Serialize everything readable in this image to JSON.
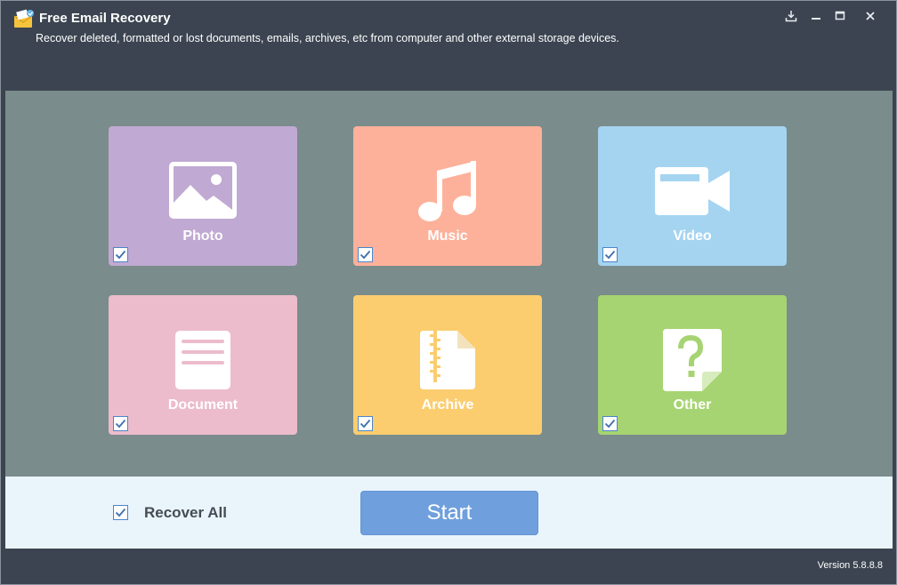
{
  "window": {
    "title": "Free Email Recovery",
    "subtitle": "Recover deleted, formatted or lost documents, emails, archives, etc from computer and other external storage devices.",
    "controls": [
      "download-icon",
      "minimize-icon",
      "maximize-icon",
      "close-icon"
    ]
  },
  "categories": [
    {
      "label": "Photo",
      "checked": true,
      "color": "#c0a9d2",
      "icon": "photo-icon"
    },
    {
      "label": "Music",
      "checked": true,
      "color": "#fdb19a",
      "icon": "music-icon"
    },
    {
      "label": "Video",
      "checked": true,
      "color": "#a5d4f1",
      "icon": "video-icon"
    },
    {
      "label": "Document",
      "checked": true,
      "color": "#ecbccc",
      "icon": "document-icon"
    },
    {
      "label": "Archive",
      "checked": true,
      "color": "#fbcd6f",
      "icon": "archive-icon"
    },
    {
      "label": "Other",
      "checked": true,
      "color": "#a7d472",
      "icon": "question-icon"
    }
  ],
  "bottom": {
    "recover_all_label": "Recover All",
    "recover_all_checked": true,
    "start_label": "Start"
  },
  "footer": {
    "version": "Version 5.8.8.8"
  },
  "colors": {
    "titlebar": "#3b4450",
    "main_bg": "#7a8c8b",
    "bottom_bg": "#eaf4fb",
    "start_button": "#6fa0dd",
    "checkbox_border": "#4c86c8"
  }
}
